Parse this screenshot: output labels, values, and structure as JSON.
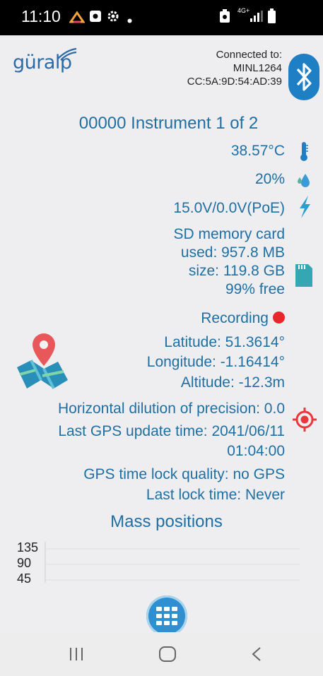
{
  "status_bar": {
    "time": "11:10",
    "network_label": "4G+",
    "icons": [
      "home-app-icon",
      "notification-icon",
      "gear-icon",
      "dot-icon",
      "battery-saver-icon",
      "signal-icon",
      "battery-icon"
    ]
  },
  "header": {
    "logo_text": "güralp",
    "connected_label": "Connected to:",
    "device_name": "MINL1264",
    "mac_address": "CC:5A:9D:54:AD:39"
  },
  "instrument": {
    "title": "00000 Instrument 1 of 2",
    "temperature": "38.57°C",
    "humidity": "20%",
    "power": "15.0V/0.0V(PoE)",
    "sd_title": "SD memory card",
    "sd_used": "used: 957.8 MB",
    "sd_size": "size: 119.8 GB",
    "sd_free": "99% free",
    "recording_label": "Recording"
  },
  "gps": {
    "latitude": "Latitude: 51.3614°",
    "longitude": "Longitude: -1.16414°",
    "altitude": "Altitude: -12.3m",
    "hdop": "Horizontal dilution of precision: 0.0",
    "last_update_line1": "Last GPS update time: 2041/06/11",
    "last_update_line2": "01:04:00",
    "lock_quality": "GPS time lock quality: no GPS",
    "last_lock": "Last lock time: Never"
  },
  "mass_positions": {
    "title": "Mass positions",
    "chart_data": {
      "type": "line",
      "title": "Mass positions",
      "ytick_labels": [
        "135",
        "90",
        "45"
      ]
    }
  },
  "colors": {
    "primary_text": "#1f6fa3",
    "background": "#eeeef0",
    "accent_blue": "#1f7fc4",
    "recording_red": "#e8262b",
    "status_bar": "#000000"
  }
}
